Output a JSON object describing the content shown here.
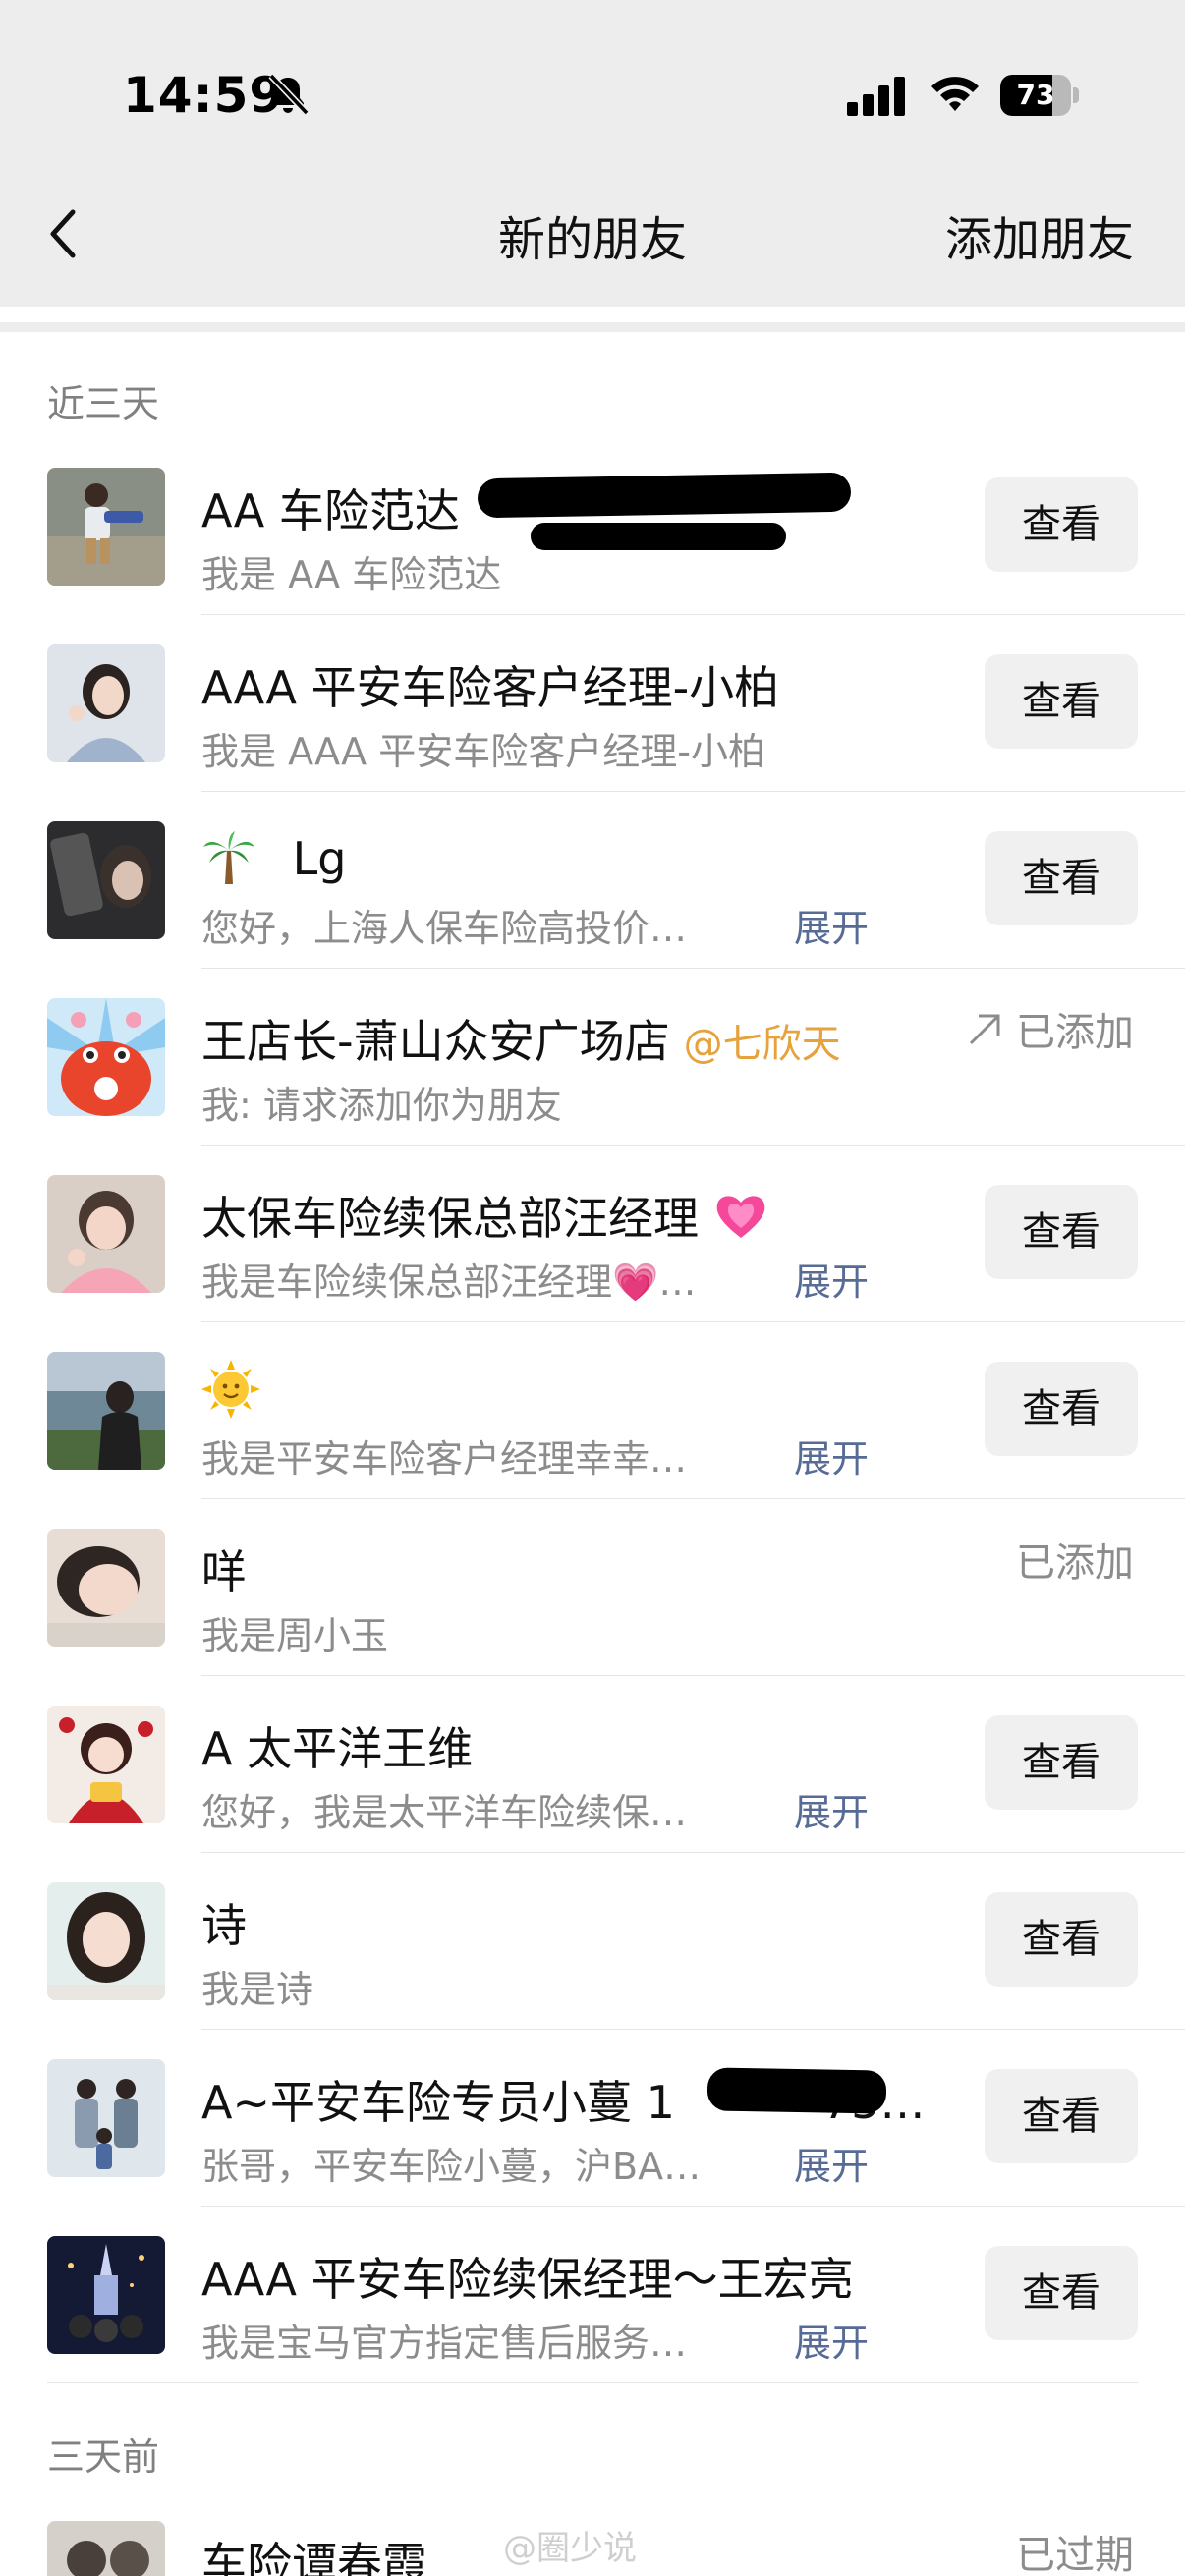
{
  "status_bar": {
    "time": "14:59",
    "battery": "73",
    "battery_level": 0.73,
    "icons": [
      "bell-slash-icon",
      "signal-icon",
      "wifi-icon",
      "battery-icon"
    ]
  },
  "nav": {
    "title": "新的朋友",
    "right_action": "添加朋友",
    "back_icon": "chevron-left-icon"
  },
  "sections": {
    "recent": "近三天",
    "earlier": "三天前"
  },
  "view_label": "查看",
  "expand_label": "展开",
  "rows": [
    {
      "title": "AA 车险范达",
      "subtitle": "我是 AA 车险范达",
      "action": "view"
    },
    {
      "title": "AAA 平安车险客户经理-小柏",
      "subtitle": "我是 AAA 平安车险客户经理-小柏",
      "action": "view"
    },
    {
      "title": "Lg",
      "title_emoji": "🌴",
      "subtitle": "您好，上海人保车险高投价…",
      "expand": true,
      "action": "view"
    },
    {
      "title": "王店长-萧山众安广场店",
      "tag": "@七欣天",
      "subtitle": "我: 请求添加你为朋友",
      "action": "added",
      "status": "已添加"
    },
    {
      "title": "太保车险续保总部汪经理",
      "title_emoji": "💗",
      "subtitle": "我是车险续保总部汪经理💗…",
      "expand": true,
      "action": "view"
    },
    {
      "title": "",
      "title_emoji": "🌞",
      "subtitle": "我是平安车险客户经理幸幸…",
      "expand": true,
      "action": "view"
    },
    {
      "title": "咩",
      "subtitle": "我是周小玉",
      "action": "added",
      "status": "已添加"
    },
    {
      "title": "A 太平洋王维",
      "subtitle": "您好，我是太平洋车险续保…",
      "expand": true,
      "action": "view"
    },
    {
      "title": "诗",
      "subtitle": "我是诗",
      "action": "view"
    },
    {
      "title": "A~平安车险专员小蔓 1",
      "title_tail": "75…",
      "subtitle": "张哥，平安车险小蔓，沪BA…",
      "expand": true,
      "action": "view"
    },
    {
      "title": "AAA 平安车险续保经理～王宏亮",
      "subtitle": "我是宝马官方指定售后服务…",
      "expand": true,
      "action": "view"
    },
    {
      "title": "车险谭春霞",
      "subtitle": "",
      "action": "expired",
      "status": "已过期"
    }
  ],
  "watermark": "@圈少说",
  "colors": {
    "header_bg": "#ededed",
    "link_blue": "#576b95",
    "tag_orange": "#e6a23c",
    "muted_gray": "#8c8c8c",
    "button_bg": "#f0f0f0"
  }
}
